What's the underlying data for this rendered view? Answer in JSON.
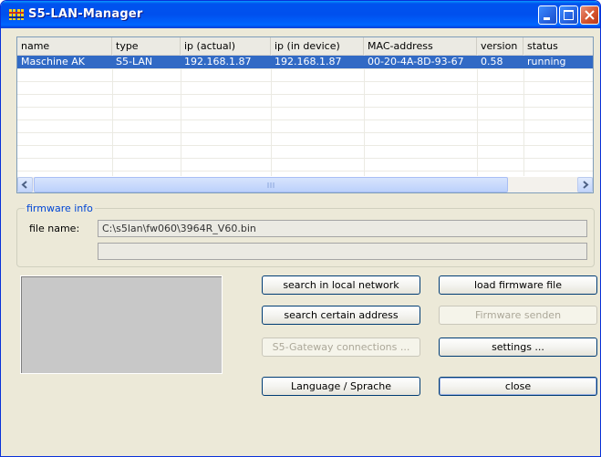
{
  "window": {
    "title": "S5-LAN-Manager"
  },
  "table": {
    "columns": [
      "name",
      "type",
      "ip (actual)",
      "ip (in device)",
      "MAC-address",
      "version",
      "status"
    ],
    "rows": [
      [
        "Maschine AK",
        "S5-LAN",
        "192.168.1.87",
        "192.168.1.87",
        "00-20-4A-8D-93-67",
        "0.58",
        "running"
      ]
    ],
    "selected_row": 0
  },
  "firmware": {
    "group_label": "firmware info",
    "file_label": "file name:",
    "file_value": "C:\\s5lan\\fw060\\3964R_V60.bin",
    "second_value": ""
  },
  "buttons": {
    "search_local": "search in local network",
    "load_firmware": "load firmware file",
    "search_address": "search certain address",
    "send_firmware": "Firmware senden",
    "gateway_connections": "S5-Gateway connections ...",
    "settings": "settings ...",
    "language": "Language / Sprache",
    "close": "close"
  },
  "colors": {
    "title_bar": "#0054E3",
    "selection": "#316AC5",
    "group_label": "#0046D5"
  },
  "icons": {
    "app": "s5-app-icon",
    "minimize": "minimize-icon",
    "maximize": "maximize-icon",
    "close": "close-icon",
    "scroll_left": "scroll-left-icon",
    "scroll_right": "scroll-right-icon"
  }
}
